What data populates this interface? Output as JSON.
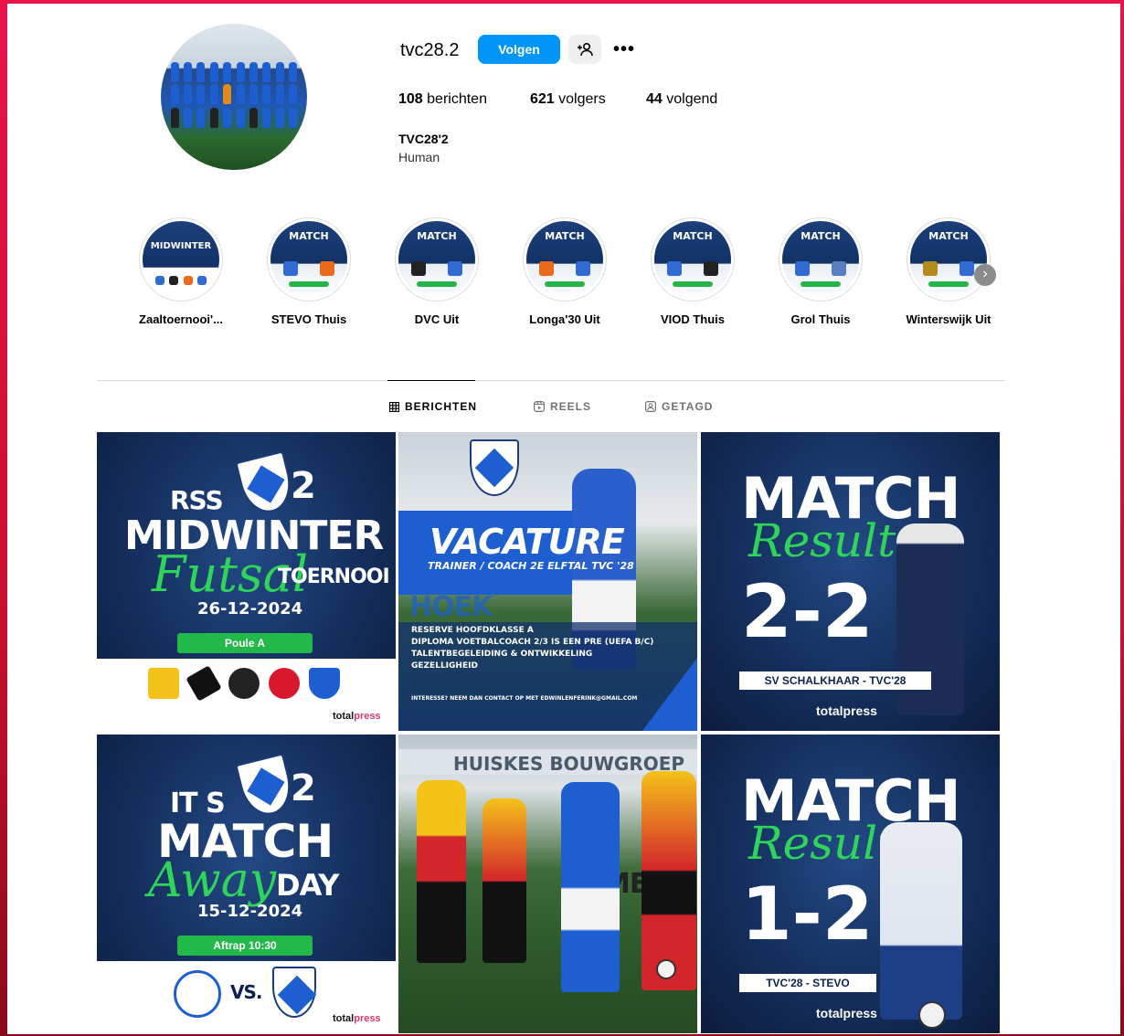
{
  "profile": {
    "username": "tvc28.2",
    "follow_label": "Volgen",
    "posts_count": "108",
    "posts_label": "berichten",
    "followers_count": "621",
    "followers_label": "volgers",
    "following_count": "44",
    "following_label": "volgend",
    "full_name": "TVC28'2",
    "category": "Human"
  },
  "highlights": [
    {
      "label": "Zaaltoernooi'...",
      "thumb_text": "MIDWINTER"
    },
    {
      "label": "STEVO Thuis",
      "thumb_text": "MATCH"
    },
    {
      "label": "DVC Uit",
      "thumb_text": "MATCH"
    },
    {
      "label": "Longa'30 Uit",
      "thumb_text": "MATCH"
    },
    {
      "label": "VIOD Thuis",
      "thumb_text": "MATCH"
    },
    {
      "label": "Grol Thuis",
      "thumb_text": "MATCH"
    },
    {
      "label": "Winterswijk Uit",
      "thumb_text": "MATCH"
    }
  ],
  "tabs": [
    {
      "label": "BERICHTEN",
      "active": true
    },
    {
      "label": "REELS",
      "active": false
    },
    {
      "label": "GETAGD",
      "active": false
    }
  ],
  "posts": {
    "p1": {
      "line1": "RSS",
      "line2": "MIDWINTER",
      "script": "Futsal",
      "line3": "TOERNOOI",
      "date": "26-12-2024",
      "pill": "Poule A",
      "brand1": "total",
      "brand2": "press",
      "team_no": "2"
    },
    "p2": {
      "title": "VACATURE",
      "subtitle": "TRAINER / COACH 2E ELFTAL TVC '28",
      "ad_hoek": "HOEK",
      "bullets": [
        "RESERVE HOOFDKLASSE A",
        "DIPLOMA VOETBALCOACH 2/3 IS EEN PRE (UEFA B/C)",
        "TALENTBEGELEIDING & ONTWIKKELING",
        "GEZELLIGHEID"
      ],
      "contact": "INTERESSE? NEEM DAN CONTACT OP MET EDWINLENFERINK@GMAIL.COM"
    },
    "p3": {
      "title": "MATCH",
      "script": "Result",
      "score": "2-2",
      "caption": "SV SCHALKHAAR - TVC'28",
      "brand": "totalpress"
    },
    "p4": {
      "line1": "IT S",
      "line2": "MATCH",
      "script": "Away",
      "line3": "DAY",
      "date": "15-12-2024",
      "pill": "Aftrap 10:30",
      "vs": "VS.",
      "brand1": "total",
      "brand2": "press",
      "team_no": "2"
    },
    "p5": {
      "banner": "HUISKES BOUWGROEP",
      "sign": "MEN"
    },
    "p6": {
      "title": "MATCH",
      "script": "Result",
      "score": "1-2",
      "caption": "TVC'28 - STEVO",
      "brand": "totalpress"
    }
  },
  "colors": {
    "follow_blue": "#0095f6",
    "club_blue": "#1d5fd0",
    "accent_green": "#22b84a",
    "frame_red": "#e8144a"
  },
  "icons": [
    "add-user-icon",
    "more-icon",
    "chevron-right-icon",
    "grid-icon",
    "reels-icon",
    "tagged-icon"
  ]
}
